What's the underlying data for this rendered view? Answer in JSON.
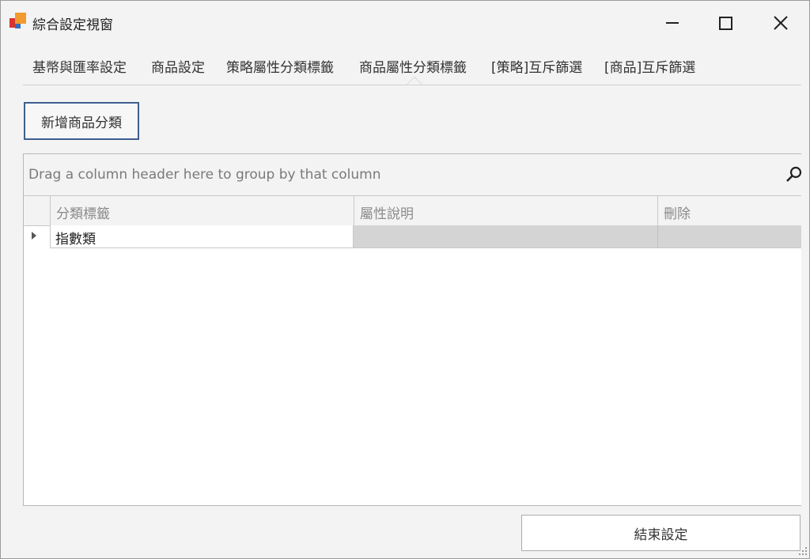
{
  "window": {
    "title": "綜合設定視窗",
    "buttons": [
      "minimize",
      "maximize",
      "close"
    ]
  },
  "tabs": [
    {
      "label": "基幣與匯率設定",
      "active": false
    },
    {
      "label": "商品設定",
      "active": false
    },
    {
      "label": "策略屬性分類標籤",
      "active": false
    },
    {
      "label": "商品屬性分類標籤",
      "active": true
    },
    {
      "label": "[策略]互斥篩選",
      "active": false
    },
    {
      "label": "[商品]互斥篩選",
      "active": false
    }
  ],
  "add_button": {
    "label": "新增商品分類"
  },
  "grid": {
    "group_panel_text": "Drag a column header here to group by that column",
    "columns": [
      "分類標籤",
      "屬性說明",
      "刪除"
    ],
    "rows": [
      {
        "category": "指數類",
        "description": "",
        "delete": ""
      }
    ]
  },
  "finish_button": {
    "label": "結束設定"
  },
  "icons": {
    "app": "app-logo-icon",
    "search": "search-icon",
    "row_indicator": "row-indicator-icon",
    "grip": "resize-grip-icon"
  },
  "colors": {
    "accent_border": "#3e5f8f",
    "readonly_cell": "#d4d4d4",
    "background": "#f3f3f3"
  }
}
